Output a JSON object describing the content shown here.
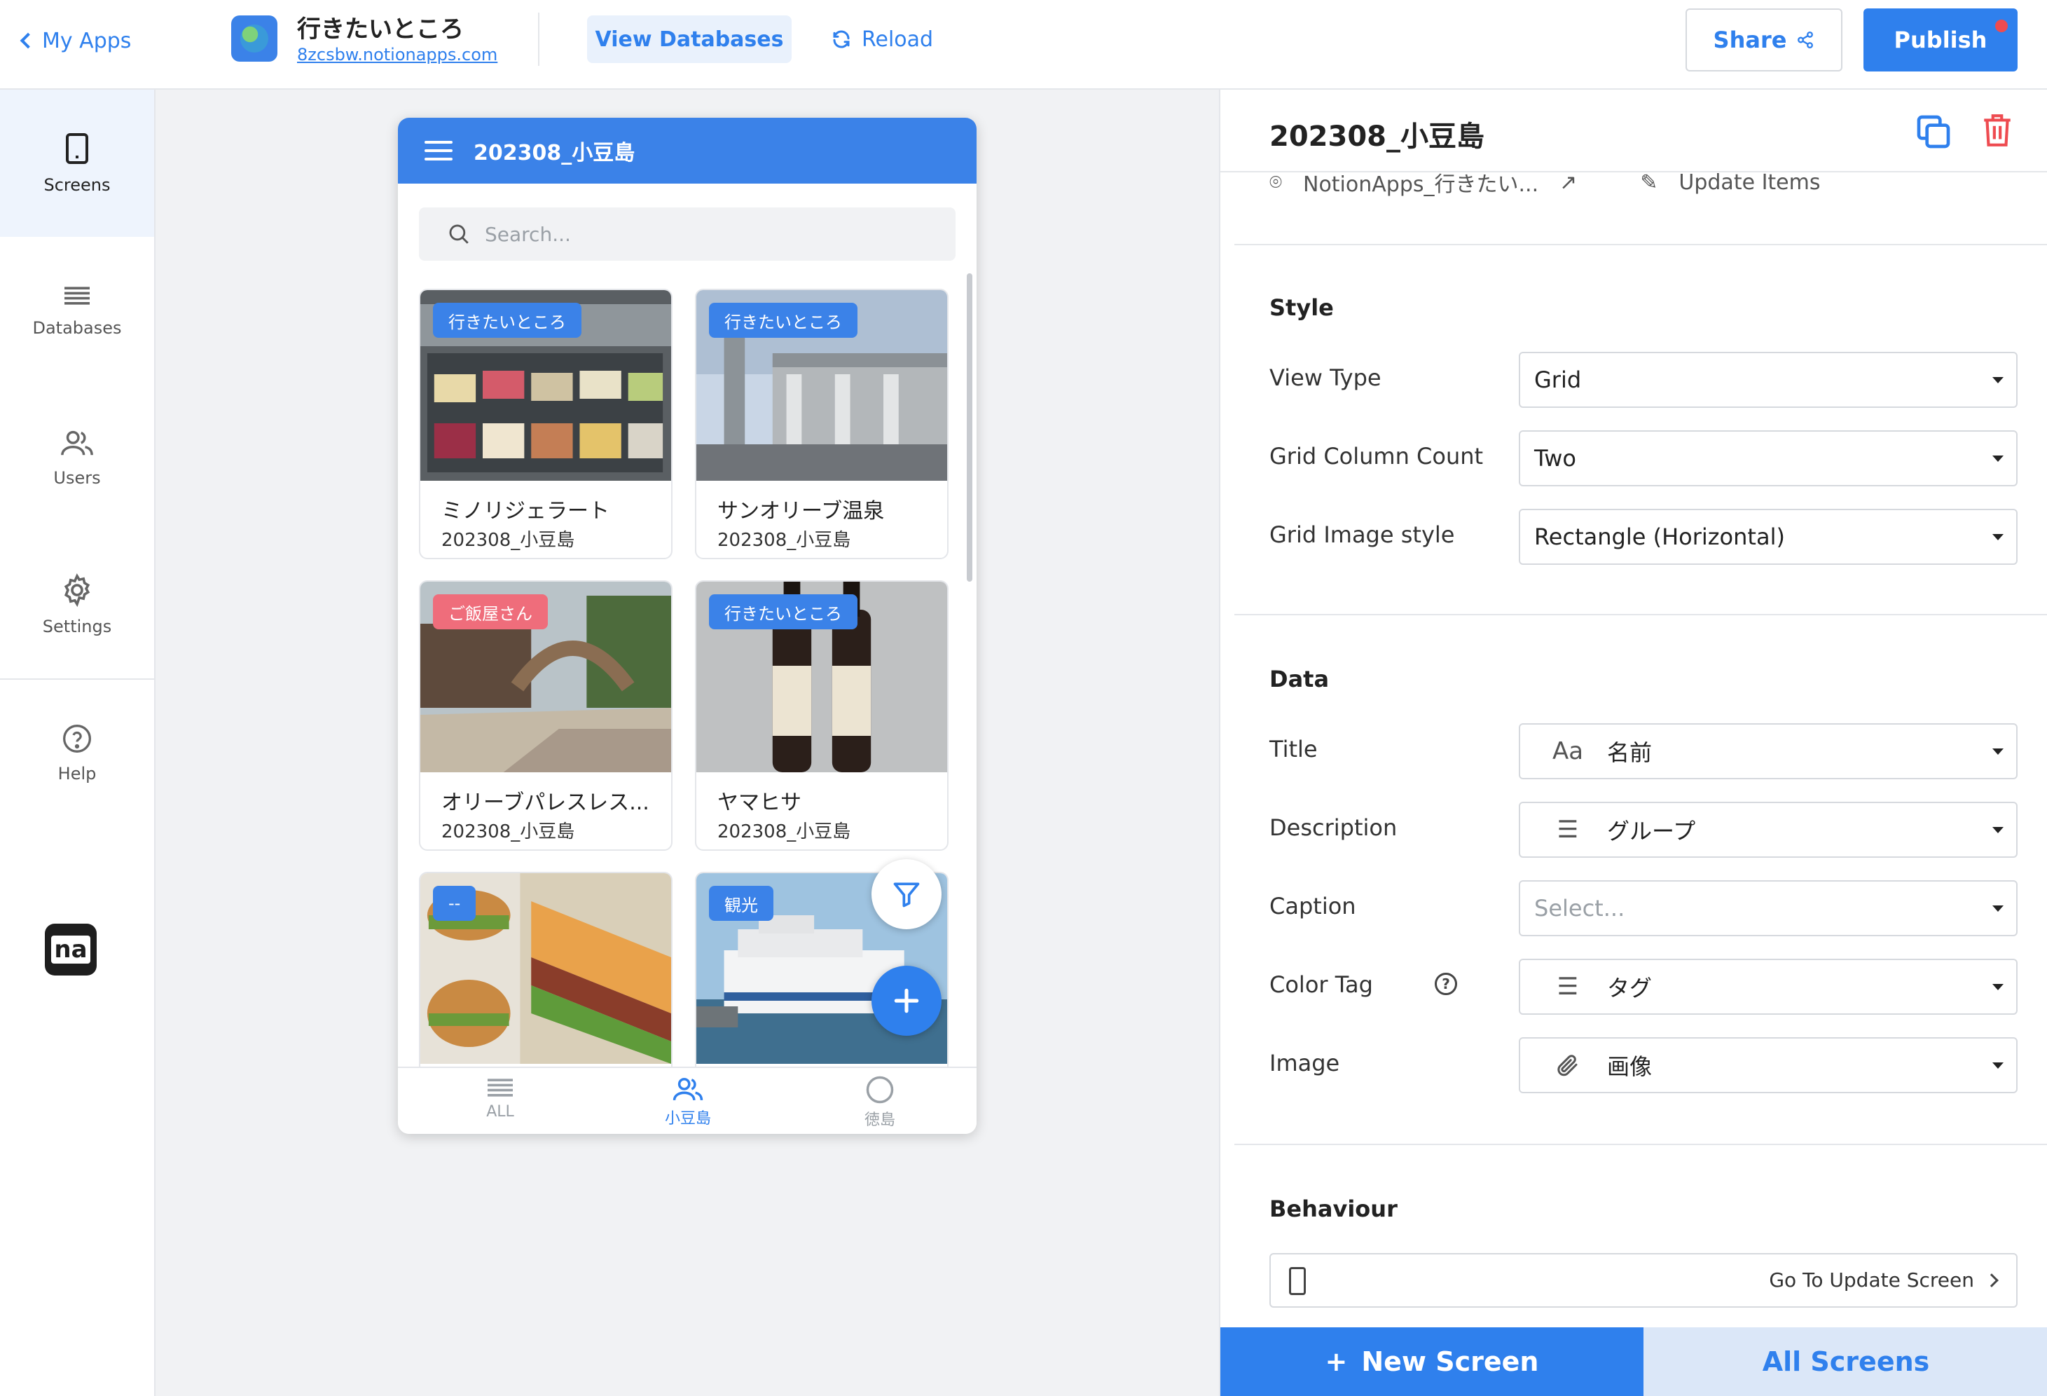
{
  "topbar": {
    "back_label": "My Apps",
    "app_title": "行きたいところ",
    "app_url": "8zcsbw.notionapps.com",
    "view_databases": "View Databases",
    "reload": "Reload",
    "share": "Share",
    "publish": "Publish"
  },
  "nav": {
    "items": [
      {
        "label": "Screens",
        "icon": "tablet-icon",
        "active": true
      },
      {
        "label": "Databases",
        "icon": "list-icon",
        "active": false
      },
      {
        "label": "Users",
        "icon": "users-icon",
        "active": false
      },
      {
        "label": "Settings",
        "icon": "gear-icon",
        "active": false
      },
      {
        "label": "Help",
        "icon": "help-icon",
        "active": false
      }
    ],
    "logo_text": "na"
  },
  "phone": {
    "title": "202308_小豆島",
    "search_placeholder": "Search...",
    "cards": [
      {
        "tag": "行きたいところ",
        "tag_color": "#3b82e8",
        "title": "ミノリジェラート",
        "subtitle": "202308_小豆島"
      },
      {
        "tag": "行きたいところ",
        "tag_color": "#3b82e8",
        "title": "サンオリーブ温泉",
        "subtitle": "202308_小豆島"
      },
      {
        "tag": "ご飯屋さん",
        "tag_color": "#ef6d7b",
        "title": "オリーブパレスレス...",
        "subtitle": "202308_小豆島"
      },
      {
        "tag": "行きたいところ",
        "tag_color": "#3b82e8",
        "title": "ヤマヒサ",
        "subtitle": "202308_小豆島"
      },
      {
        "tag": "--",
        "tag_color": "#3b82e8",
        "title": "",
        "subtitle": ""
      },
      {
        "tag": "観光",
        "tag_color": "#3b82e8",
        "title": "",
        "subtitle": ""
      }
    ],
    "tabs": [
      {
        "label": "ALL",
        "icon": "list-icon",
        "active": false
      },
      {
        "label": "小豆島",
        "icon": "users-icon",
        "active": true
      },
      {
        "label": "徳島",
        "icon": "circle-icon",
        "active": false
      }
    ]
  },
  "panel": {
    "title": "202308_小豆島",
    "cut_row": {
      "source": "NotionApps_行きたい...",
      "action": "Update Items"
    },
    "style": {
      "heading": "Style",
      "rows": [
        {
          "label": "View Type",
          "value": "Grid"
        },
        {
          "label": "Grid Column Count",
          "value": "Two"
        },
        {
          "label": "Grid Image style",
          "value": "Rectangle (Horizontal)"
        }
      ]
    },
    "data": {
      "heading": "Data",
      "rows": [
        {
          "label": "Title",
          "icon_text": "Aa",
          "value": "名前"
        },
        {
          "label": "Description",
          "icon_text": "☰",
          "value": "グループ"
        },
        {
          "label": "Caption",
          "icon_text": "",
          "value": "",
          "placeholder": "Select..."
        },
        {
          "label": "Color Tag",
          "icon_text": "☰",
          "value": "タグ"
        },
        {
          "label": "Image",
          "icon_text": "📎",
          "value": "画像"
        }
      ]
    },
    "behaviour": {
      "heading": "Behaviour",
      "action": "Go To Update Screen"
    },
    "new_screen": "New Screen",
    "new_screen_prefix": "+",
    "all_screens": "All Screens"
  }
}
